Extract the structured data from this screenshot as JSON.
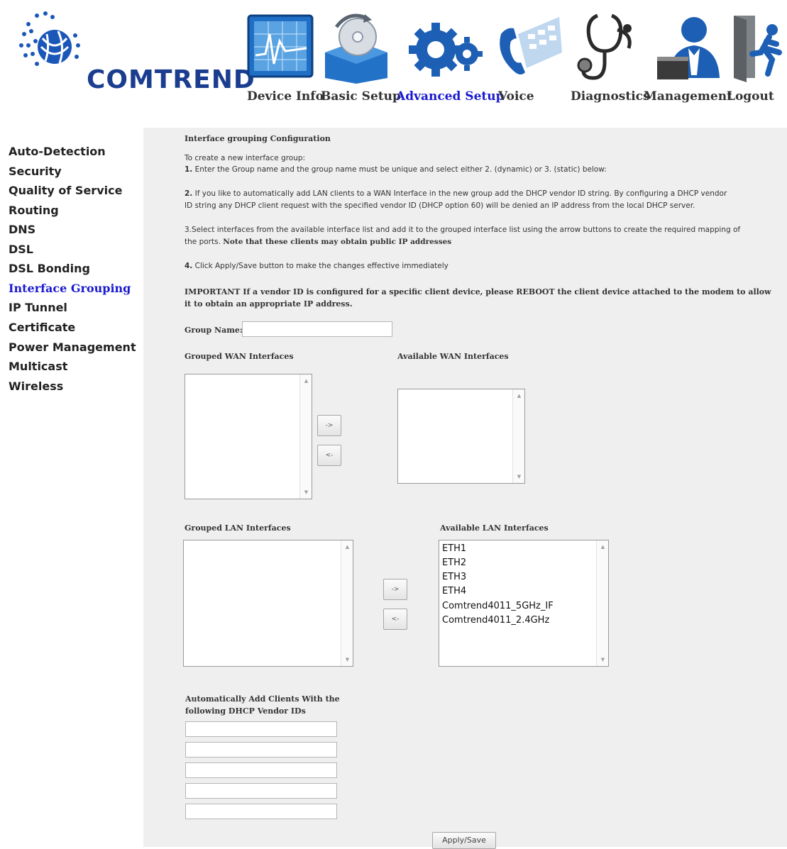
{
  "brand": {
    "name": "COMTREND"
  },
  "nav": {
    "items": [
      {
        "label": "Device Info",
        "icon": "chart-monitor-icon",
        "active": false
      },
      {
        "label": "Basic Setup",
        "icon": "disc-box-icon",
        "active": false
      },
      {
        "label": "Advanced Setup",
        "icon": "gears-icon",
        "active": true
      },
      {
        "label": "Voice",
        "icon": "phone-icon",
        "active": false
      },
      {
        "label": "Diagnostics",
        "icon": "stethoscope-icon",
        "active": false
      },
      {
        "label": "Management",
        "icon": "user-laptop-icon",
        "active": false
      },
      {
        "label": "Logout",
        "icon": "exit-door-icon",
        "active": false
      }
    ]
  },
  "sidebar": {
    "items": [
      {
        "label": "Auto-Detection"
      },
      {
        "label": "Security"
      },
      {
        "label": "Quality of Service"
      },
      {
        "label": "Routing"
      },
      {
        "label": "DNS"
      },
      {
        "label": "DSL"
      },
      {
        "label": "DSL Bonding"
      },
      {
        "label": "Interface Grouping",
        "active": true
      },
      {
        "label": "IP Tunnel"
      },
      {
        "label": "Certificate"
      },
      {
        "label": "Power Management"
      },
      {
        "label": "Multicast"
      },
      {
        "label": "Wireless"
      }
    ]
  },
  "page": {
    "title": "Interface grouping Configuration",
    "intro": "To create a new interface group:",
    "step1_num": "1.",
    "step1": "Enter the Group name and the group name must be unique and select either 2. (dynamic) or 3. (static) below:",
    "step2_num": "2.",
    "step2_line1": "If you like to automatically add LAN clients to a WAN Interface in the new group add the DHCP vendor ID string. By configuring a DHCP vendor",
    "step2_line2": "ID string any DHCP client request with the specified vendor ID (DHCP option 60) will be denied an IP address from the local DHCP server.",
    "step3_line1": "3.Select interfaces from the available interface list and add it to the grouped interface list using the arrow buttons to create the required mapping of",
    "step3_line2a": "the ports.",
    "step3_line2b": "Note that these clients may obtain public IP addresses",
    "step4_num": "4.",
    "step4": "Click Apply/Save button to make the changes effective immediately",
    "important_line1": "IMPORTANT If a vendor ID is configured for a specific client device, please REBOOT the client device attached to the modem to allow",
    "important_line2": "it to obtain an appropriate IP address.",
    "group_name_label": "Group Name:",
    "group_name_value": "",
    "grouped_wan_label": "Grouped WAN Interfaces",
    "available_wan_label": "Available WAN Interfaces",
    "grouped_wan": [],
    "available_wan": [],
    "grouped_lan_label": "Grouped LAN Interfaces",
    "available_lan_label": "Available LAN Interfaces",
    "grouped_lan": [],
    "available_lan": [
      "ETH1",
      "ETH2",
      "ETH3",
      "ETH4",
      "Comtrend4011_5GHz_IF",
      "Comtrend4011_2.4GHz"
    ],
    "add_arrow": "->",
    "remove_arrow": "<-",
    "vendor_ids_label_line1": "Automatically Add Clients With the",
    "vendor_ids_label_line2": "following DHCP Vendor IDs",
    "vendor_ids": [
      "",
      "",
      "",
      "",
      ""
    ],
    "apply_button": "Apply/Save"
  }
}
